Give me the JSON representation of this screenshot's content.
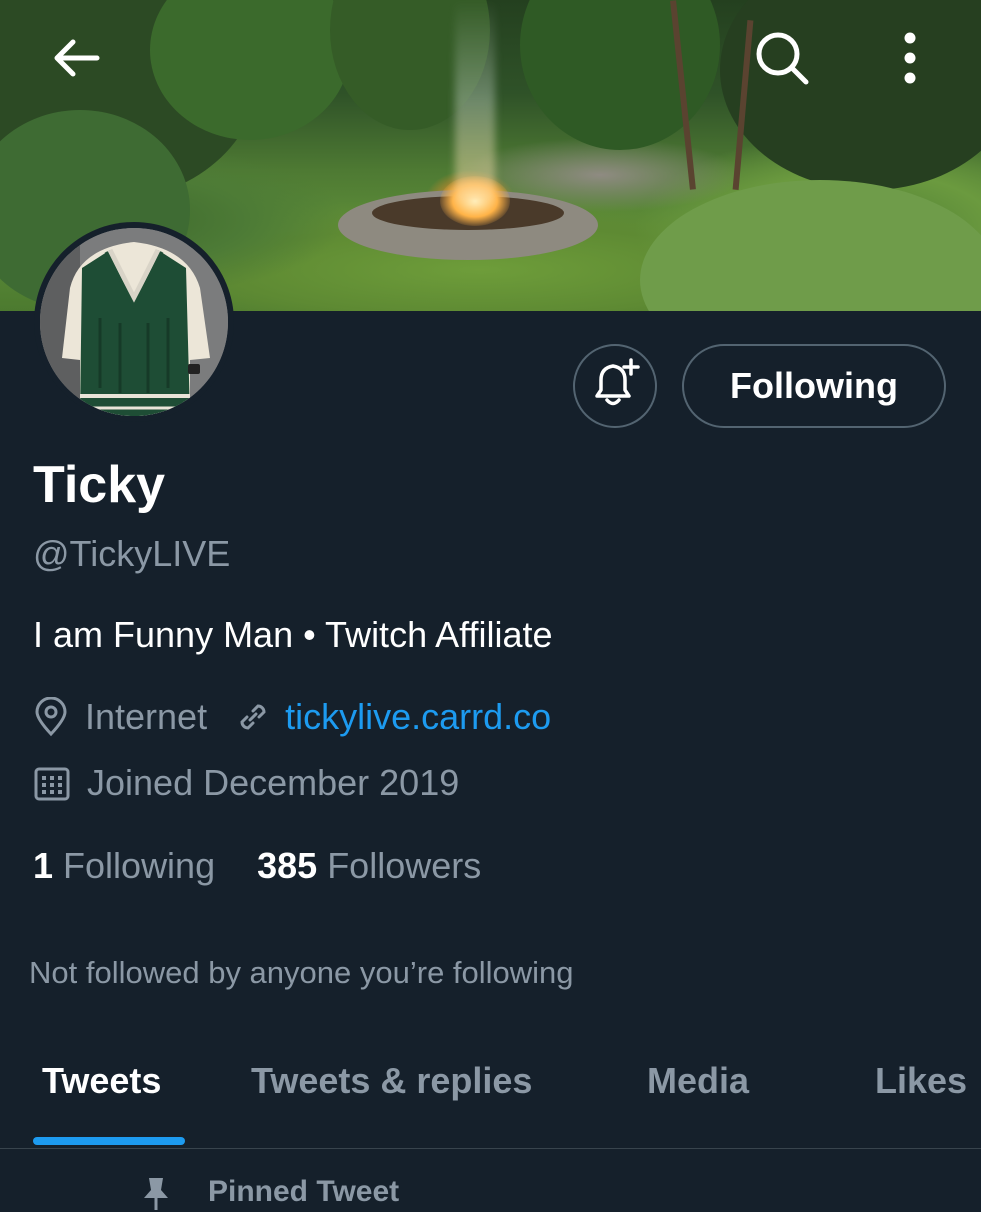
{
  "profile": {
    "name": "Ticky",
    "handle": "@TickyLIVE",
    "bio": "I am Funny Man • Twitch Affiliate",
    "location": "Internet",
    "website": "tickylive.carrd.co",
    "joined": "Joined December 2019"
  },
  "actions": {
    "following_label": "Following"
  },
  "stats": {
    "following_count": "1",
    "following_label": " Following",
    "followers_count": "385",
    "followers_label": " Followers"
  },
  "social_context": "Not followed by anyone you’re following",
  "tabs": [
    {
      "label": "Tweets",
      "active": true
    },
    {
      "label": "Tweets & replies",
      "active": false
    },
    {
      "label": "Media",
      "active": false
    },
    {
      "label": "Likes",
      "active": false
    }
  ],
  "pinned": {
    "label": "Pinned Tweet"
  },
  "icons": {
    "back": "back-arrow-icon",
    "search": "search-icon",
    "more": "more-vertical-icon",
    "notify": "bell-plus-icon",
    "location": "location-pin-icon",
    "link": "link-icon",
    "calendar": "calendar-icon",
    "pin": "pin-icon"
  },
  "colors": {
    "background": "#15202b",
    "accent": "#1d9bf0",
    "secondary_text": "#8b98a5",
    "border": "#536471"
  }
}
